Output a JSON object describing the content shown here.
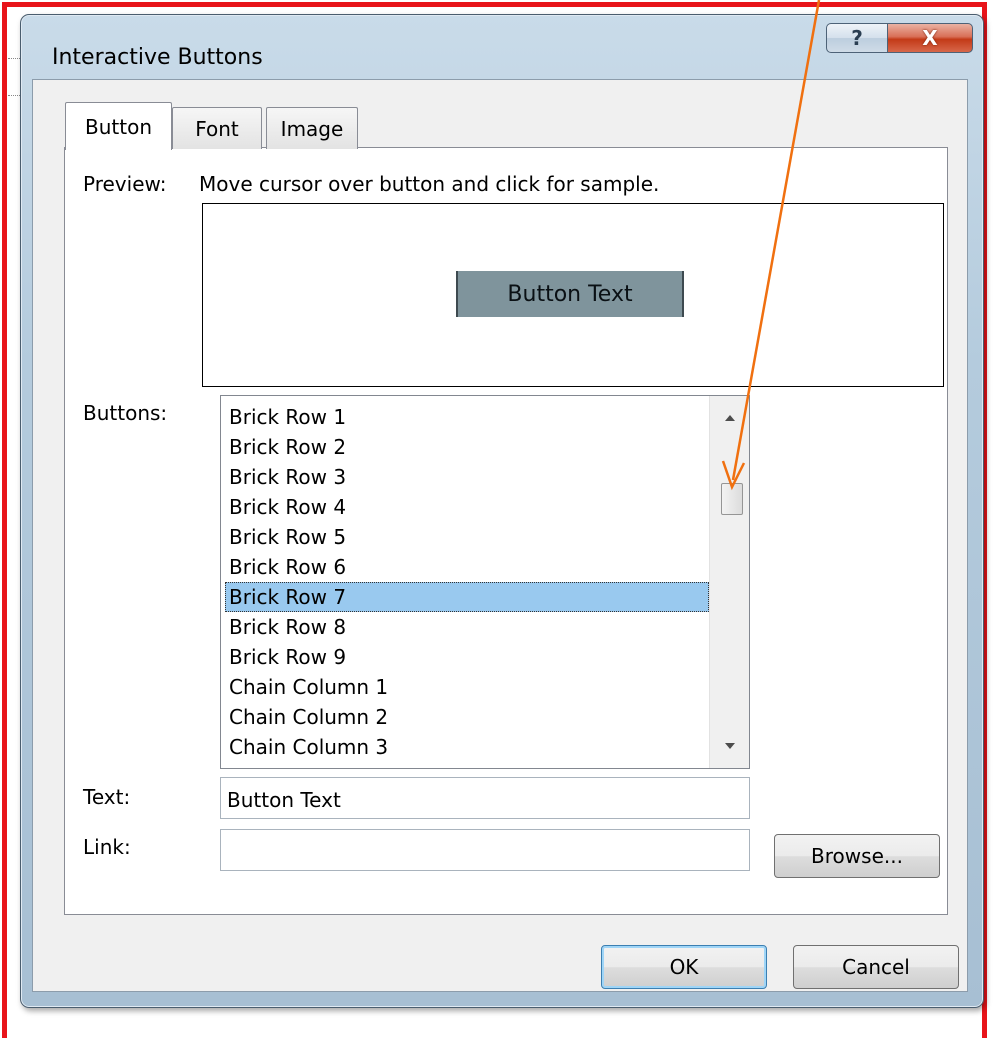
{
  "window": {
    "title": "Interactive Buttons",
    "help_glyph": "?",
    "close_glyph": "X"
  },
  "tabs": [
    {
      "label": "Button",
      "active": true
    },
    {
      "label": "Font",
      "active": false
    },
    {
      "label": "Image",
      "active": false
    }
  ],
  "preview": {
    "label": "Preview:",
    "hint": "Move cursor over button and click for sample.",
    "sample_button_text": "Button Text"
  },
  "buttons_list": {
    "label": "Buttons:",
    "items": [
      "Brick Row 1",
      "Brick Row 2",
      "Brick Row 3",
      "Brick Row 4",
      "Brick Row 5",
      "Brick Row 6",
      "Brick Row 7",
      "Brick Row 8",
      "Brick Row 9",
      "Chain Column 1",
      "Chain Column 2",
      "Chain Column 3"
    ],
    "selected": "Brick Row 7"
  },
  "text_field": {
    "label": "Text:",
    "value": "Button Text"
  },
  "link_field": {
    "label": "Link:",
    "value": ""
  },
  "actions": {
    "browse": "Browse...",
    "ok": "OK",
    "cancel": "Cancel"
  },
  "colors": {
    "annotation_frame": "#e8141a",
    "annotation_arrow": "#f07010",
    "selection": "#99c9ef",
    "sample_button": "#7f949c"
  },
  "icons": [
    "help-icon",
    "close-icon",
    "scroll-up-arrow-icon",
    "scroll-down-arrow-icon"
  ]
}
